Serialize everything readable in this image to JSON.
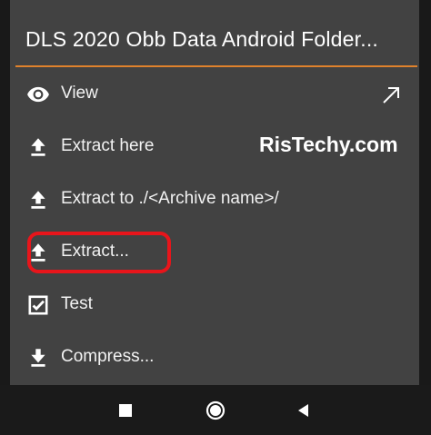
{
  "dialog": {
    "title": "DLS 2020 Obb Data Android Folder..."
  },
  "menu": {
    "items": [
      {
        "label": "View",
        "icon": "eye-icon"
      },
      {
        "label": "Extract here",
        "icon": "upload-icon"
      },
      {
        "label": "Extract to ./<Archive name>/",
        "icon": "upload-icon"
      },
      {
        "label": "Extract...",
        "icon": "upload-icon"
      },
      {
        "label": "Test",
        "icon": "checkbox-icon"
      },
      {
        "label": "Compress...",
        "icon": "download-icon"
      }
    ]
  },
  "watermark": "RisTechy.com",
  "nav": {
    "buttons": [
      "recents-square-icon",
      "home-circle-icon",
      "back-triangle-icon"
    ]
  },
  "colors": {
    "dialog_bg": "#424242",
    "divider": "#e0822c",
    "highlight": "#e8151b",
    "text": "#ffffff"
  }
}
